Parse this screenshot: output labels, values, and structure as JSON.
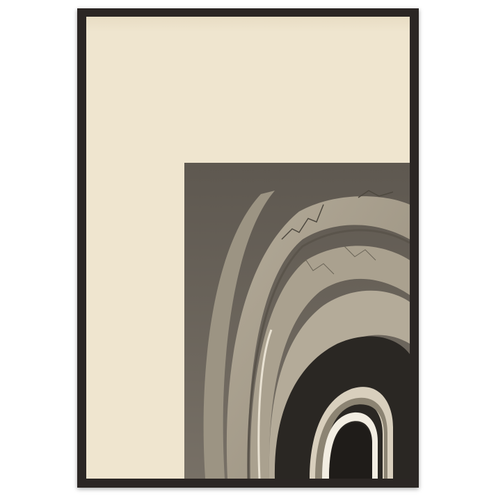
{
  "scene": {
    "subject": "framed-abstract-print",
    "colors": {
      "frame": "#2b2624",
      "mat": "#efe5cf",
      "artwork_background": "#6b655b",
      "arch_tone": "#a89f8e",
      "dark_band": "#2a2723",
      "light_band": "#d8cfbd"
    }
  }
}
